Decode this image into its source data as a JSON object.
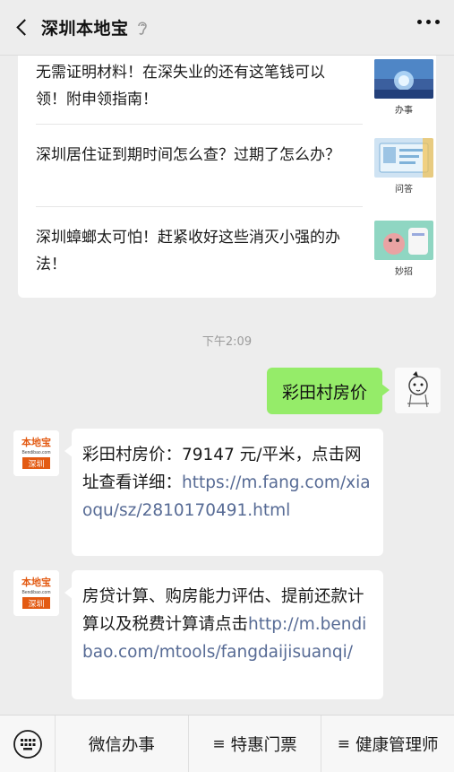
{
  "header": {
    "title": "深圳本地宝"
  },
  "articles": [
    {
      "title": "无需证明材料！在深失业的还有这笔钱可以领！附申领指南！",
      "tag": "办事"
    },
    {
      "title": "深圳居住证到期时间怎么查？过期了怎么办？",
      "tag": "问答"
    },
    {
      "title": "深圳蟑螂太可怕！赶紧收好这些消灭小强的办法！",
      "tag": "妙招"
    }
  ],
  "chat": {
    "timestamp": "下午2:09",
    "user_message": "彩田村房价",
    "reply1_text": "彩田村房价：79147 元/平米，点击网址查看详细：",
    "reply1_link": "https://m.fang.com/xiaoqu/sz/2810170491.html",
    "reply2_text": "房贷计算、购房能力评估、提前还款计算以及税费计算请点击",
    "reply2_link": "http://m.bendibao.com/mtools/fangdaijisuanqi/",
    "bot_logo_text": "本地宝",
    "bot_logo_sub": "Bendibao.com",
    "bot_logo_city": "深圳"
  },
  "menu": {
    "item1": "微信办事",
    "item2": "特惠门票",
    "item3": "健康管理师",
    "menu_glyph": "≡"
  }
}
